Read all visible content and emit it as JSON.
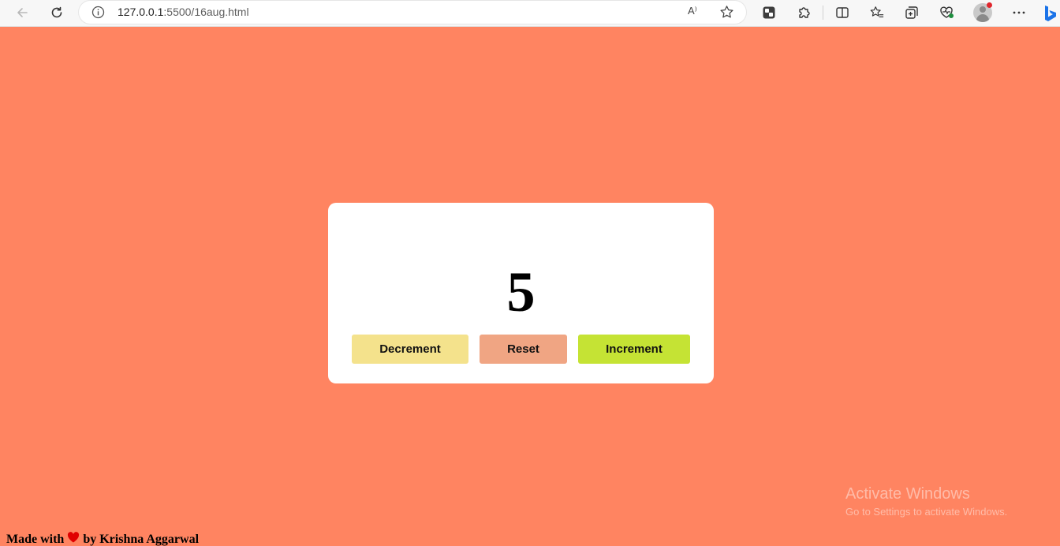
{
  "browser": {
    "url_host": "127.0.0.1",
    "url_path": ":5500/16aug.html",
    "read_aloud_label": "A⁾"
  },
  "counter": {
    "value": "5",
    "decrement_label": "Decrement",
    "reset_label": "Reset",
    "increment_label": "Increment"
  },
  "footer": {
    "prefix": "Made with",
    "suffix": "by Krishna Aggarwal"
  },
  "watermark": {
    "title": "Activate Windows",
    "subtitle": "Go to Settings to activate Windows."
  },
  "colors": {
    "page_background": "#ff8461",
    "decrement_button": "#f4e28c",
    "reset_button": "#f0a583",
    "increment_button": "#c5e334",
    "heart": "#e00000"
  }
}
